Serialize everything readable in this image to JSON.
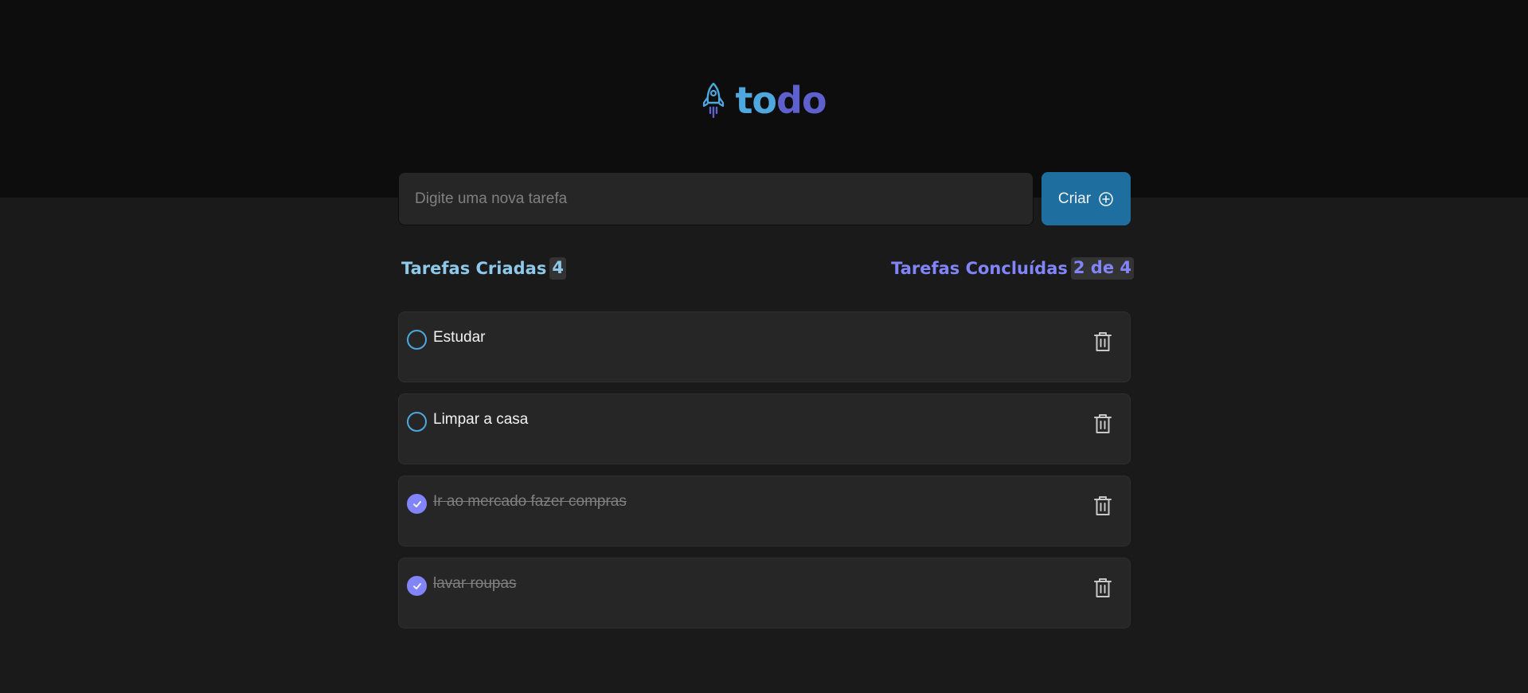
{
  "header": {
    "logo_icon": "rocket-icon",
    "logo_part1": "to",
    "logo_part2": "do",
    "colors": {
      "blue": "#4ea8de",
      "purple": "#5e60ce"
    }
  },
  "form": {
    "placeholder": "Digite uma nova tarefa",
    "value": "",
    "create_label": "Criar",
    "create_icon": "plus-circle-icon"
  },
  "counters": {
    "created_label": "Tarefas Criadas",
    "created_count": "4",
    "done_label": "Tarefas Concluídas",
    "done_count": "2 de 4"
  },
  "tasks": [
    {
      "text": "Estudar",
      "done": false
    },
    {
      "text": "Limpar a casa",
      "done": false
    },
    {
      "text": "Ir ao mercado fazer compras",
      "done": true
    },
    {
      "text": "lavar roupas",
      "done": true
    }
  ]
}
